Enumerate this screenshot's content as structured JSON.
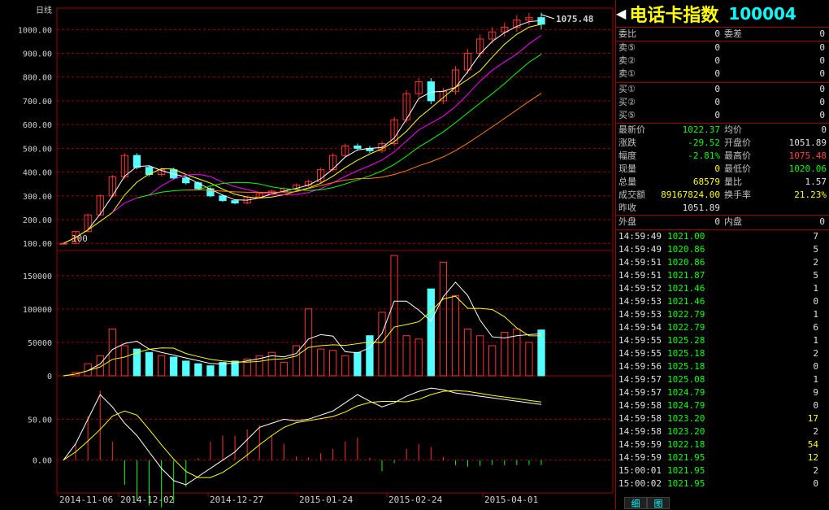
{
  "chart": {
    "period_label": "日线",
    "last_price_label": "1075.48",
    "start_marker": "100",
    "price_ticks": [
      "1000.00",
      "900.00",
      "800.00",
      "700.00",
      "600.00",
      "500.00",
      "400.00",
      "300.00",
      "200.00",
      "100.00"
    ],
    "volume_ticks": [
      "150000",
      "100000",
      "50000",
      "0"
    ],
    "indicator_ticks": [
      "50.00",
      "0.00"
    ],
    "date_ticks": [
      "2014-11-06",
      "2014-12-02",
      "2014-12-27",
      "2015-01-24",
      "2015-02-24",
      "2015-04-01"
    ],
    "colors": {
      "up": "#ff3030",
      "down": "#54ffff",
      "grid": "#a00000",
      "ma5": "#ffffff",
      "ma10": "#ffff00",
      "ma20": "#ff00ff",
      "ma30": "#00ff00",
      "ma60": "#ff8000"
    }
  },
  "chart_data": {
    "type": "candlestick",
    "price_ylim": [
      70,
      1090
    ],
    "volume_ylim": [
      0,
      185000
    ],
    "indicator_ylim": [
      -40,
      100
    ],
    "x": [
      "2014-11-06",
      "2014-11-10",
      "2014-11-12",
      "2014-11-14",
      "2014-11-18",
      "2014-11-20",
      "2014-11-24",
      "2014-11-26",
      "2014-11-28",
      "2014-12-02",
      "2014-12-04",
      "2014-12-08",
      "2014-12-10",
      "2014-12-12",
      "2014-12-16",
      "2014-12-18",
      "2014-12-22",
      "2014-12-24",
      "2014-12-27",
      "2014-12-31",
      "2015-01-05",
      "2015-01-08",
      "2015-01-12",
      "2015-01-15",
      "2015-01-20",
      "2015-01-24",
      "2015-01-28",
      "2015-02-02",
      "2015-02-06",
      "2015-02-12",
      "2015-02-17",
      "2015-02-24",
      "2015-02-28",
      "2015-03-05",
      "2015-03-11",
      "2015-03-16",
      "2015-03-20",
      "2015-03-25",
      "2015-03-30",
      "2015-04-01"
    ],
    "close": [
      100,
      150,
      220,
      300,
      380,
      470,
      420,
      390,
      410,
      375,
      355,
      330,
      300,
      280,
      270,
      295,
      310,
      320,
      330,
      345,
      360,
      410,
      470,
      510,
      500,
      490,
      520,
      620,
      730,
      780,
      700,
      740,
      830,
      900,
      960,
      990,
      1010,
      1040,
      1050,
      1022.37
    ],
    "volume": [
      0,
      5000,
      18000,
      30000,
      70000,
      45000,
      40000,
      35000,
      30000,
      28000,
      22000,
      18000,
      15000,
      20000,
      22000,
      25000,
      30000,
      35000,
      20000,
      45000,
      100000,
      40000,
      38000,
      30000,
      35000,
      60000,
      95000,
      180000,
      60000,
      55000,
      130000,
      170000,
      120000,
      70000,
      60000,
      45000,
      65000,
      70000,
      50000,
      68579
    ],
    "macd": [
      0,
      20,
      50,
      80,
      65,
      45,
      30,
      10,
      -10,
      -25,
      -30,
      -20,
      -10,
      0,
      10,
      25,
      40,
      45,
      50,
      48,
      50,
      55,
      60,
      70,
      80,
      72,
      65,
      70,
      78,
      84,
      88,
      86,
      82,
      80,
      78,
      76,
      74,
      72,
      70,
      68
    ]
  },
  "panel": {
    "title": "电话卡指数",
    "code": "100004",
    "weibi_label": "委比",
    "weibi_value": "0",
    "weicha_label": "委差",
    "weicha_value": "0",
    "sell": [
      {
        "label": "卖⑤",
        "price": "0",
        "vol": "0"
      },
      {
        "label": "卖②",
        "price": "0",
        "vol": "0"
      },
      {
        "label": "卖①",
        "price": "0",
        "vol": "0"
      }
    ],
    "buy": [
      {
        "label": "买①",
        "price": "0",
        "vol": "0"
      },
      {
        "label": "买②",
        "price": "0",
        "vol": "0"
      },
      {
        "label": "买⑤",
        "price": "0",
        "vol": "0"
      }
    ],
    "stats_left": [
      {
        "label": "最新价",
        "value": "1022.37",
        "cls": "grn"
      },
      {
        "label": "涨跌",
        "value": "-29.52",
        "cls": "grn"
      },
      {
        "label": "幅度",
        "value": "-2.81%",
        "cls": "grn"
      },
      {
        "label": "现量",
        "value": "0",
        "cls": "ylw"
      },
      {
        "label": "总量",
        "value": "68579",
        "cls": "ylw"
      },
      {
        "label": "成交额",
        "value": "89167824.00",
        "cls": "ylw"
      },
      {
        "label": "昨收",
        "value": "1051.89",
        "cls": "wht"
      }
    ],
    "stats_right": [
      {
        "label": "均价",
        "value": "0",
        "cls": "wht"
      },
      {
        "label": "开盘价",
        "value": "1051.89",
        "cls": "wht"
      },
      {
        "label": "最高价",
        "value": "1075.48",
        "cls": "red"
      },
      {
        "label": "最低价",
        "value": "1020.06",
        "cls": "grn"
      },
      {
        "label": "量比",
        "value": "1.57",
        "cls": "wht"
      },
      {
        "label": "换手率",
        "value": "21.23%",
        "cls": "ylw"
      }
    ],
    "waipan_label": "外盘",
    "waipan_value": "0",
    "neipan_label": "内盘",
    "neipan_value": "0",
    "ticks": [
      {
        "time": "14:59:49",
        "price": "1021.00",
        "vol": "7"
      },
      {
        "time": "14:59:49",
        "price": "1020.86",
        "vol": "5"
      },
      {
        "time": "14:59:51",
        "price": "1020.86",
        "vol": "2"
      },
      {
        "time": "14:59:51",
        "price": "1021.87",
        "vol": "5"
      },
      {
        "time": "14:59:52",
        "price": "1021.46",
        "vol": "1"
      },
      {
        "time": "14:59:53",
        "price": "1021.46",
        "vol": "0"
      },
      {
        "time": "14:59:53",
        "price": "1022.79",
        "vol": "1"
      },
      {
        "time": "14:59:54",
        "price": "1022.79",
        "vol": "6"
      },
      {
        "time": "14:59:55",
        "price": "1025.28",
        "vol": "1"
      },
      {
        "time": "14:59:55",
        "price": "1025.18",
        "vol": "2"
      },
      {
        "time": "14:59:56",
        "price": "1025.18",
        "vol": "0"
      },
      {
        "time": "14:59:57",
        "price": "1025.08",
        "vol": "1"
      },
      {
        "time": "14:59:57",
        "price": "1024.79",
        "vol": "9"
      },
      {
        "time": "14:59:58",
        "price": "1024.79",
        "vol": "0"
      },
      {
        "time": "14:59:58",
        "price": "1023.20",
        "vol": "17"
      },
      {
        "time": "14:59:58",
        "price": "1023.20",
        "vol": "2"
      },
      {
        "time": "14:59:59",
        "price": "1022.18",
        "vol": "54"
      },
      {
        "time": "14:59:59",
        "price": "1021.95",
        "vol": "12"
      },
      {
        "time": "15:00:01",
        "price": "1021.95",
        "vol": "2"
      },
      {
        "time": "15:00:02",
        "price": "1021.95",
        "vol": "0"
      }
    ],
    "tabs": [
      "细",
      "图"
    ]
  }
}
